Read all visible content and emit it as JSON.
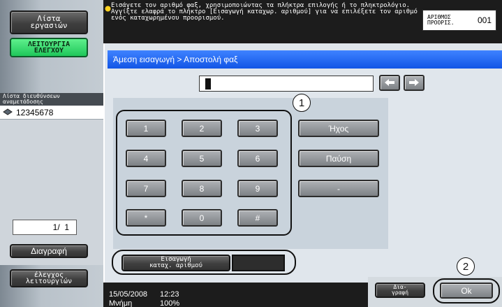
{
  "left_menu": {
    "job_list": "Λίστα\nεργασιών",
    "check_function": "ΛΕΙΤΟΥΡΓΙΑ\nΕΛΕΓΧΟΥ",
    "address_list_title": "Λίστα διευθύνσεων\nαναμετάδοσης",
    "address_item": "12345678",
    "page_counter": "1/  1",
    "delete_button": "Διαγραφή",
    "check_settings": "έλεγχος\nλειτουργιών"
  },
  "message": {
    "text": "Εισάγετε τον αριθμό φαξ, χρησιμοποιώντας τα πλήκτρα επιλογής ή το πληκτρολόγιο. Αγγίξτε ελαφρά το πλήκτρο [Εισαγωγή καταχωρ. αριθμού] για να επιλέξετε τον αριθμό ενός καταχωρημένου προορισμού.",
    "dest_label": "ΑΡΙΘΜΟΣ ΠΡΟΟΡΙΣ.",
    "dest_value": "001"
  },
  "breadcrumb": "Άμεση εισαγωγή > Αποστολή φαξ",
  "input": {
    "value": ""
  },
  "keypad": {
    "keys": [
      "1",
      "2",
      "3",
      "4",
      "5",
      "6",
      "7",
      "8",
      "9",
      "*",
      "0",
      "#"
    ]
  },
  "side_keys": {
    "tone": "Ήχος",
    "pause": "Παύση",
    "dash": "-"
  },
  "reg_number_button": "Εισαγωγή\nκαταχ. αριθμού",
  "callouts": {
    "one": "1",
    "two": "2"
  },
  "status": {
    "date": "15/05/2008",
    "time": "12:23",
    "memory_label": "Μνήμη",
    "memory_value": "100%"
  },
  "delete_small_button": "Δια-\nγραφή",
  "ok_button": "Ok",
  "colors": {
    "breadcrumb_blue": "#1d62f0",
    "green_button": "#2ed36a",
    "panel": "#e0e6ec"
  }
}
